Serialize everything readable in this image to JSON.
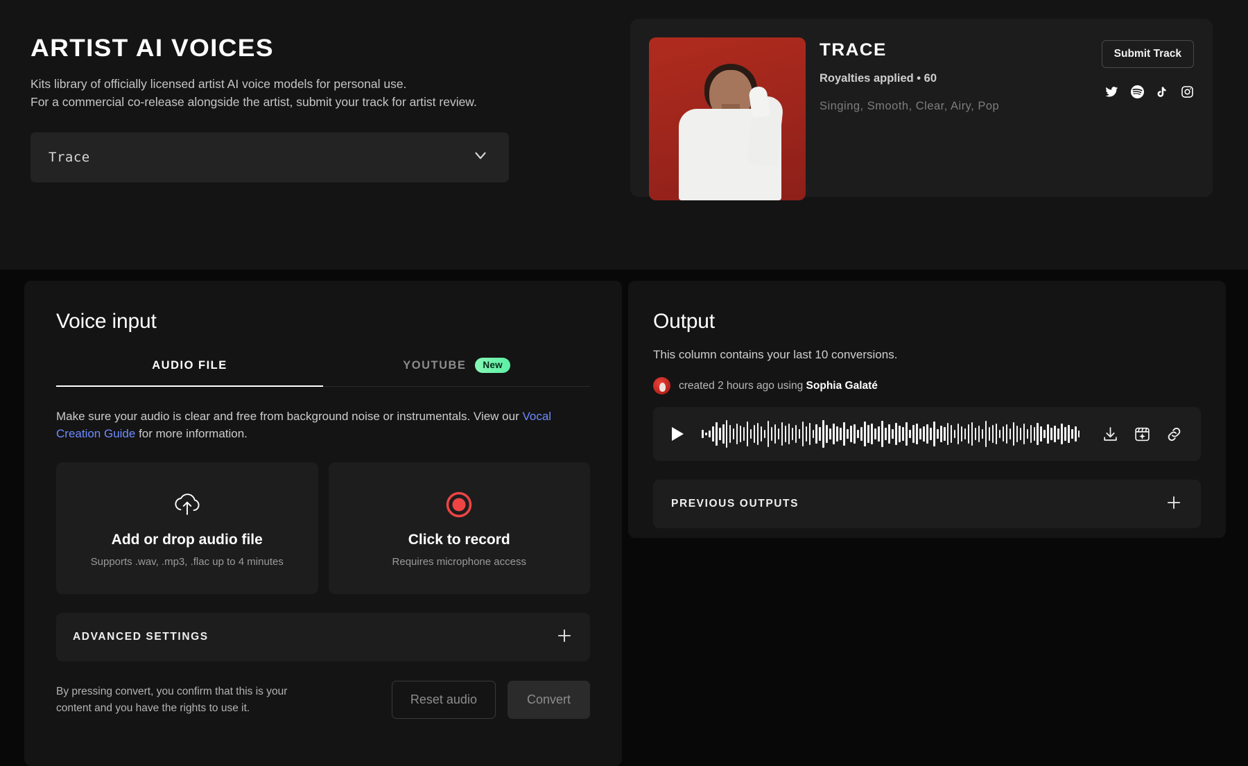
{
  "hero": {
    "title": "ARTIST AI VOICES",
    "subtitle_line1": "Kits library of officially licensed artist AI voice models for personal use.",
    "subtitle_line2": "For a commercial co-release alongside the artist, submit your track for artist review.",
    "voice_select_value": "Trace",
    "chevron_icon": "chevron-down-icon"
  },
  "artist_card": {
    "name": "TRACE",
    "meta": "Royalties applied • 60",
    "tags": "Singing, Smooth, Clear, Airy, Pop",
    "submit_label": "Submit Track",
    "photo_bg": "#a8291f",
    "socials": [
      {
        "name": "twitter-icon",
        "label": "Twitter"
      },
      {
        "name": "spotify-icon",
        "label": "Spotify"
      },
      {
        "name": "tiktok-icon",
        "label": "TikTok"
      },
      {
        "name": "instagram-icon",
        "label": "Instagram"
      }
    ]
  },
  "voice_input": {
    "title": "Voice input",
    "tabs": [
      {
        "label": "AUDIO FILE",
        "active": true,
        "badge": ""
      },
      {
        "label": "YOUTUBE",
        "active": false,
        "badge": "New"
      }
    ],
    "help_text_before": "Make sure your audio is clear and free from background noise or instrumentals. View our ",
    "help_link": "Vocal Creation Guide",
    "help_text_after": " for more information.",
    "upload_card": {
      "icon": "cloud-upload-icon",
      "title": "Add or drop audio file",
      "subtitle": "Supports .wav, .mp3, .flac up to 4 minutes"
    },
    "record_card": {
      "icon": "record-icon",
      "icon_color": "#ef4444",
      "title": "Click to record",
      "subtitle": "Requires microphone access"
    },
    "advanced_settings_label": "ADVANCED SETTINGS",
    "advanced_settings_icon": "plus-icon",
    "disclaimer": "By pressing convert, you confirm that this is your content and you have the rights to use it.",
    "reset_label": "Reset audio",
    "convert_label": "Convert"
  },
  "output": {
    "title": "Output",
    "description": "This column contains your last 10 conversions.",
    "created_prefix": "created 2 hours ago using ",
    "created_model": "Sophia Galaté",
    "avatar_icon": "artist-avatar",
    "player": {
      "play_icon": "play-icon",
      "waveform": [
        12,
        4,
        10,
        22,
        34,
        18,
        28,
        40,
        26,
        16,
        30,
        24,
        20,
        36,
        14,
        26,
        32,
        22,
        12,
        38,
        20,
        28,
        16,
        34,
        24,
        30,
        18,
        26,
        14,
        36,
        22,
        32,
        12,
        28,
        20,
        40,
        26,
        16,
        30,
        22,
        18,
        34,
        14,
        24,
        28,
        12,
        20,
        36,
        26,
        30,
        16,
        22,
        38,
        18,
        28,
        14,
        32,
        24,
        20,
        34,
        12,
        26,
        30,
        16,
        22,
        28,
        18,
        36,
        14,
        24,
        20,
        32,
        26,
        12,
        30,
        22,
        16,
        28,
        34,
        18,
        24,
        14,
        38,
        20,
        26,
        30,
        12,
        22,
        28,
        16,
        34,
        24,
        18,
        30,
        14,
        26,
        20,
        32,
        22,
        12,
        28,
        18,
        24,
        16,
        30,
        20,
        26,
        14,
        22,
        10,
        18,
        12,
        8
      ],
      "icons": [
        {
          "name": "download-icon"
        },
        {
          "name": "sparkle-box-icon"
        },
        {
          "name": "link-icon"
        }
      ]
    },
    "previous_outputs_label": "PREVIOUS OUTPUTS",
    "previous_outputs_icon": "plus-icon"
  },
  "theme": {
    "page_bg": "#080808",
    "top_bg": "#141414",
    "panel_bg": "#141414",
    "card_bg": "#1d1d1d",
    "accent_new": "#5cefa6",
    "accent_link": "#6e8cff",
    "accent_record": "#ef4444"
  }
}
